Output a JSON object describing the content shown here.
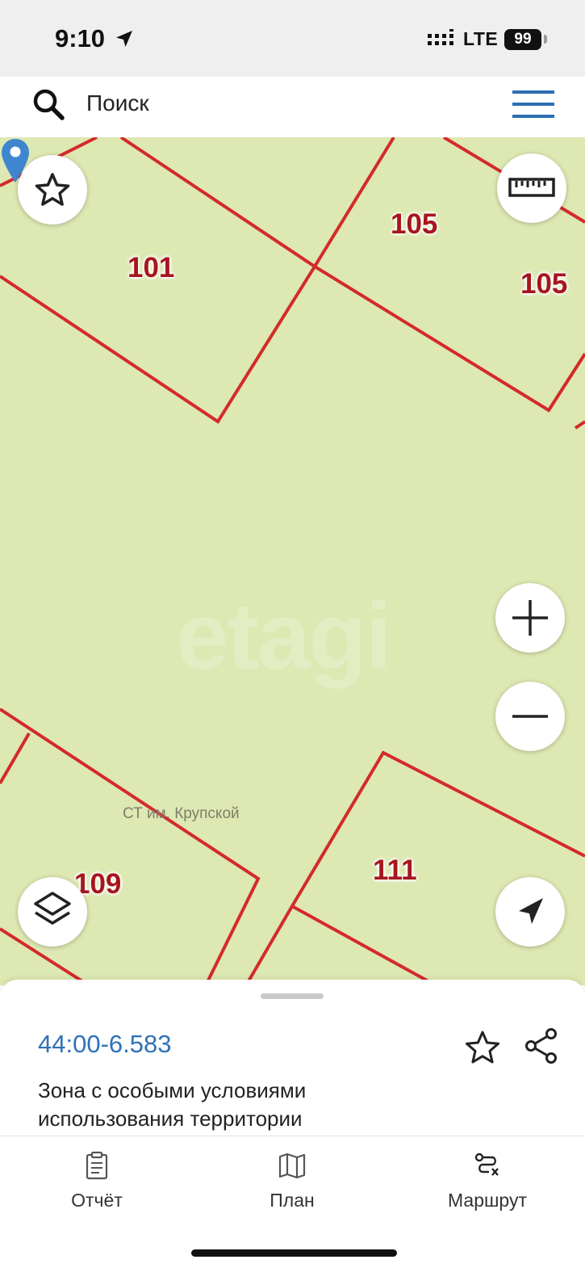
{
  "status_bar": {
    "time": "9:10",
    "network": "LTE",
    "battery": "99"
  },
  "search": {
    "placeholder": "Поиск"
  },
  "map": {
    "parcels": [
      "101",
      "105",
      "105",
      "109",
      "111"
    ],
    "place_label": "СТ им. Крупской",
    "watermark": "etagi",
    "colors": {
      "background": "#dde8b2",
      "boundary": "#d42a2a",
      "label": "#a6161c",
      "pin": "#3f86cf"
    }
  },
  "sheet": {
    "cadastral_number": "44:00-6.583",
    "zone_description": "Зона с особыми условиями использования территории"
  },
  "tabs": [
    {
      "label": "Отчёт",
      "icon": "clipboard-icon"
    },
    {
      "label": "План",
      "icon": "map-icon"
    },
    {
      "label": "Маршрут",
      "icon": "route-icon"
    }
  ]
}
